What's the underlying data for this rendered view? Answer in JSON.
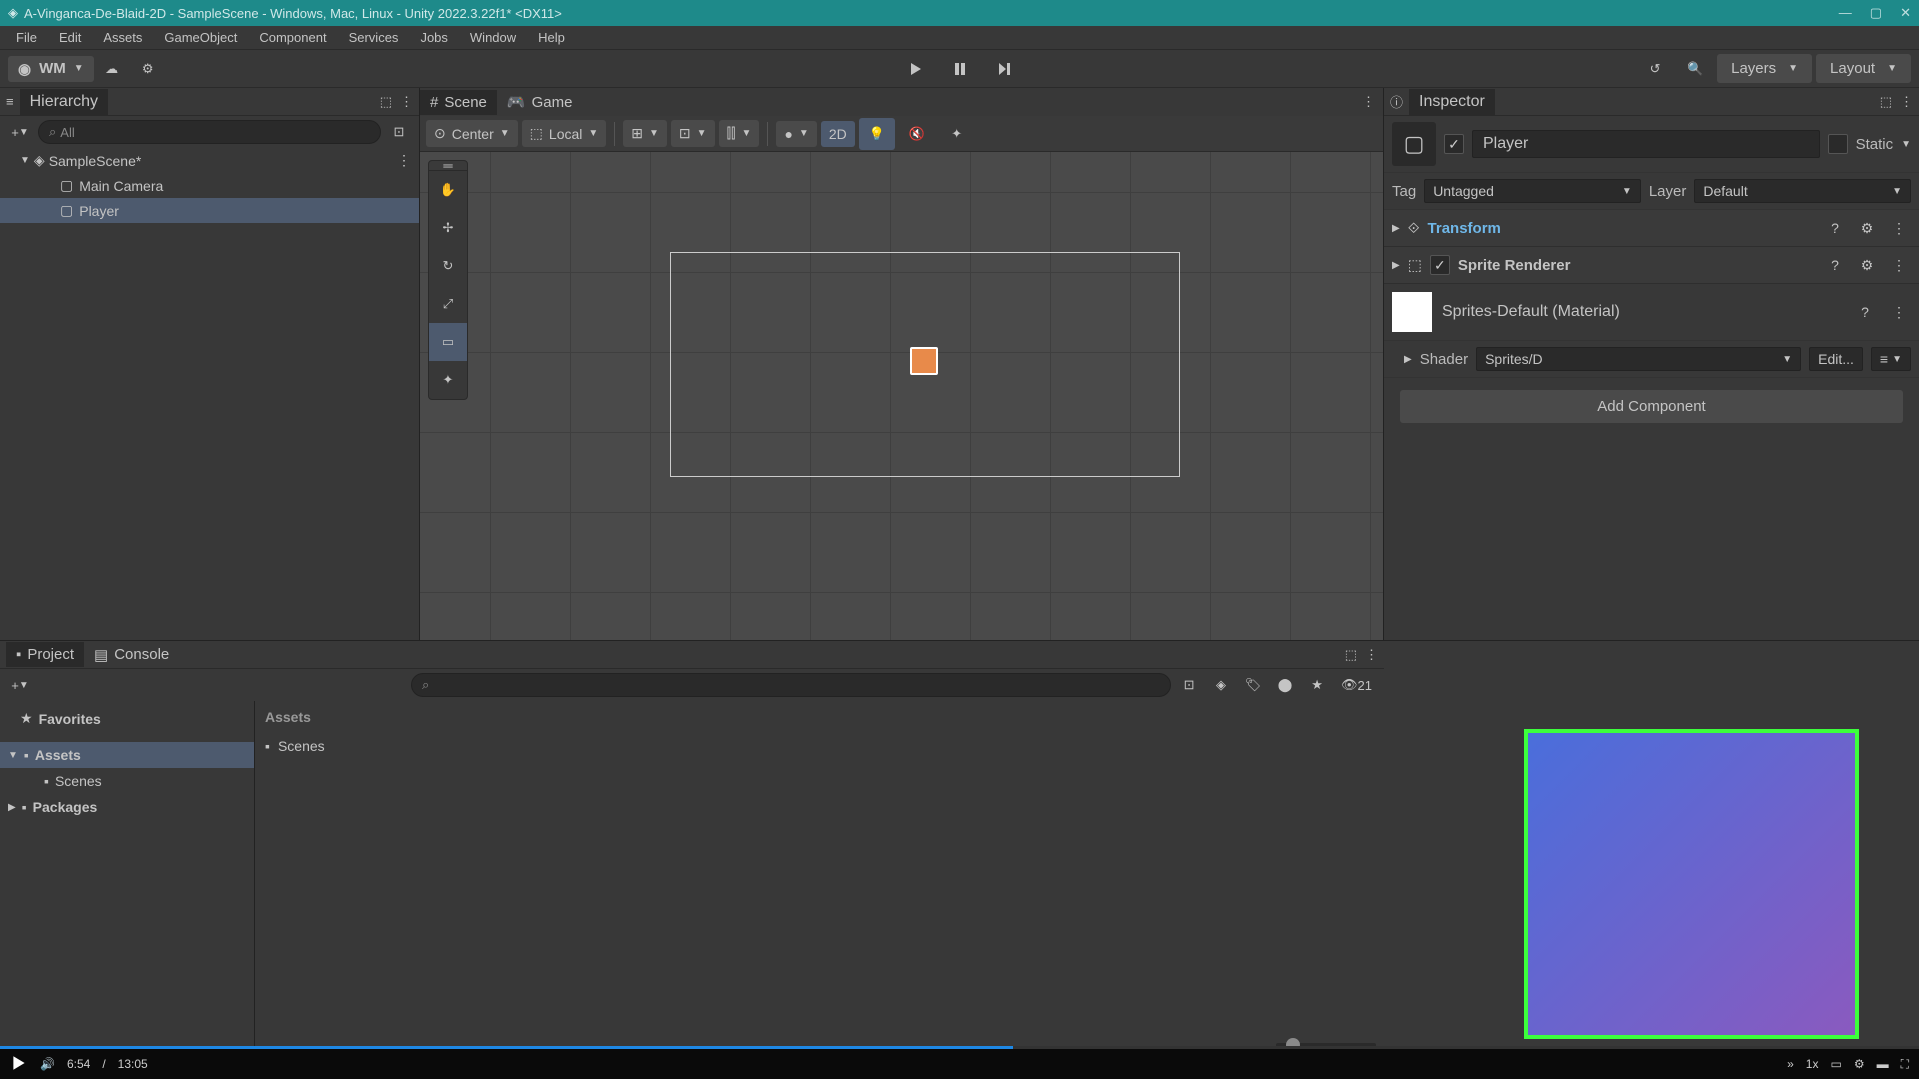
{
  "titlebar": {
    "text": "A-Vinganca-De-Blaid-2D - SampleScene - Windows, Mac, Linux - Unity 2022.3.22f1* <DX11>"
  },
  "menubar": [
    "File",
    "Edit",
    "Assets",
    "GameObject",
    "Component",
    "Services",
    "Jobs",
    "Window",
    "Help"
  ],
  "account": "WM",
  "layers_label": "Layers",
  "layout_label": "Layout",
  "hierarchy": {
    "title": "Hierarchy",
    "search_placeholder": "All",
    "scene_name": "SampleScene*",
    "items": [
      "Main Camera",
      "Player"
    ],
    "selected_index": 1
  },
  "scene_tabs": {
    "scene": "Scene",
    "game": "Game"
  },
  "scene_toolbar": {
    "pivot": "Center",
    "handle": "Local",
    "mode_2d": "2D"
  },
  "inspector": {
    "title": "Inspector",
    "name": "Player",
    "static_label": "Static",
    "tag_label": "Tag",
    "tag_value": "Untagged",
    "layer_label": "Layer",
    "layer_value": "Default",
    "components": [
      {
        "name": "Transform",
        "has_checkbox": false,
        "link": true
      },
      {
        "name": "Sprite Renderer",
        "has_checkbox": true
      }
    ],
    "material": "Sprites-Default (Material)",
    "shader_label": "Shader",
    "shader_value": "Sprites/D",
    "edit_label": "Edit...",
    "add_component": "Add Component"
  },
  "project": {
    "tabs": [
      "Project",
      "Console"
    ],
    "favorites": "Favorites",
    "assets": "Assets",
    "scenes": "Scenes",
    "packages": "Packages",
    "breadcrumb": "Assets",
    "content_folder": "Scenes",
    "hidden_count": "21"
  },
  "video": {
    "current": "6:54",
    "total": "13:05",
    "speed": "1x"
  }
}
